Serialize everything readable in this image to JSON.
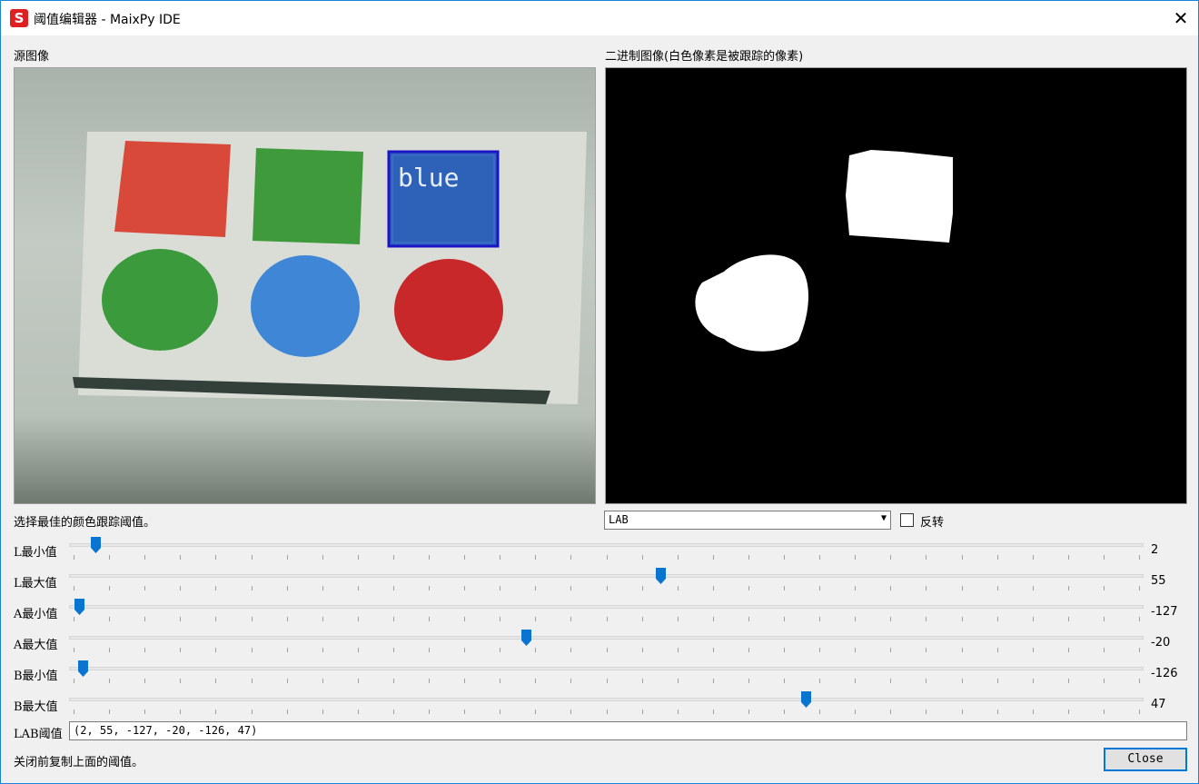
{
  "window": {
    "title": "阈值编辑器 - MaixPy IDE",
    "close_glyph": "✕",
    "app_icon_letter": "S"
  },
  "source": {
    "label": "源图像",
    "overlay_text": "blue"
  },
  "binary": {
    "label": "二进制图像(白色像素是被跟踪的像素)"
  },
  "instruction": "选择最佳的颜色跟踪阈值。",
  "colorspace": {
    "selected": "LAB",
    "invert_label": "反转",
    "invert_checked": false
  },
  "sliders": {
    "min": -128,
    "max": 127,
    "items": [
      {
        "label": "L最小值",
        "value": "2",
        "v": 2,
        "lmin": 0,
        "lmax": 100
      },
      {
        "label": "L最大值",
        "value": "55",
        "v": 55,
        "lmin": 0,
        "lmax": 100
      },
      {
        "label": "A最小值",
        "value": "-127",
        "v": -127,
        "lmin": -128,
        "lmax": 127
      },
      {
        "label": "A最大值",
        "value": "-20",
        "v": -20,
        "lmin": -128,
        "lmax": 127
      },
      {
        "label": "B最小值",
        "value": "-126",
        "v": -126,
        "lmin": -128,
        "lmax": 127
      },
      {
        "label": "B最大值",
        "value": "47",
        "v": 47,
        "lmin": -128,
        "lmax": 127
      }
    ]
  },
  "lab_threshold": {
    "label": "LAB阈值",
    "value": "(2, 55, -127, -20, -126, 47)"
  },
  "footer": {
    "note": "关闭前复制上面的阈值。",
    "close_label": "Close"
  },
  "colors": {
    "accent": "#0078d7",
    "thumb": "#0a74d1"
  }
}
